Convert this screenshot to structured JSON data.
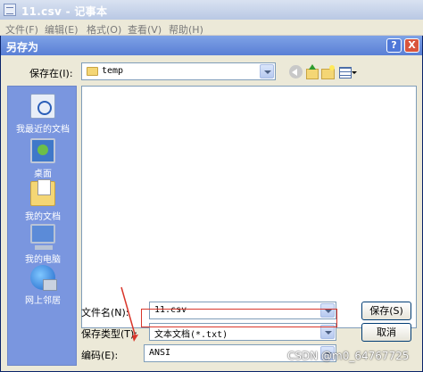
{
  "notepad": {
    "title": "11.csv - 记事本",
    "menu": [
      "文件(F)",
      "编辑(E)",
      "格式(O)",
      "查看(V)",
      "帮助(H)"
    ]
  },
  "dialog": {
    "title": "另存为",
    "help_btn": "?",
    "close_btn": "X",
    "save_in_label": "保存在(I):",
    "save_in_value": "temp",
    "places": [
      {
        "label": "我最近的文档",
        "icon": "recent-documents-icon"
      },
      {
        "label": "桌面",
        "icon": "desktop-icon"
      },
      {
        "label": "我的文档",
        "icon": "my-documents-icon"
      },
      {
        "label": "我的电脑",
        "icon": "my-computer-icon"
      },
      {
        "label": "网上邻居",
        "icon": "network-places-icon"
      }
    ],
    "filename_label": "文件名(N):",
    "filename_value": "11.csv",
    "filetype_label": "保存类型(T):",
    "filetype_value": "文本文档(*.txt)",
    "encoding_label": "编码(E):",
    "encoding_value": "ANSI",
    "save_button": "保存(S)",
    "cancel_button": "取消"
  },
  "watermark": "CSDN @m0_64767725",
  "colors": {
    "annotation": "#d9362b",
    "places_bg": "#7a96df",
    "title_bar": "#5a7fd5"
  }
}
